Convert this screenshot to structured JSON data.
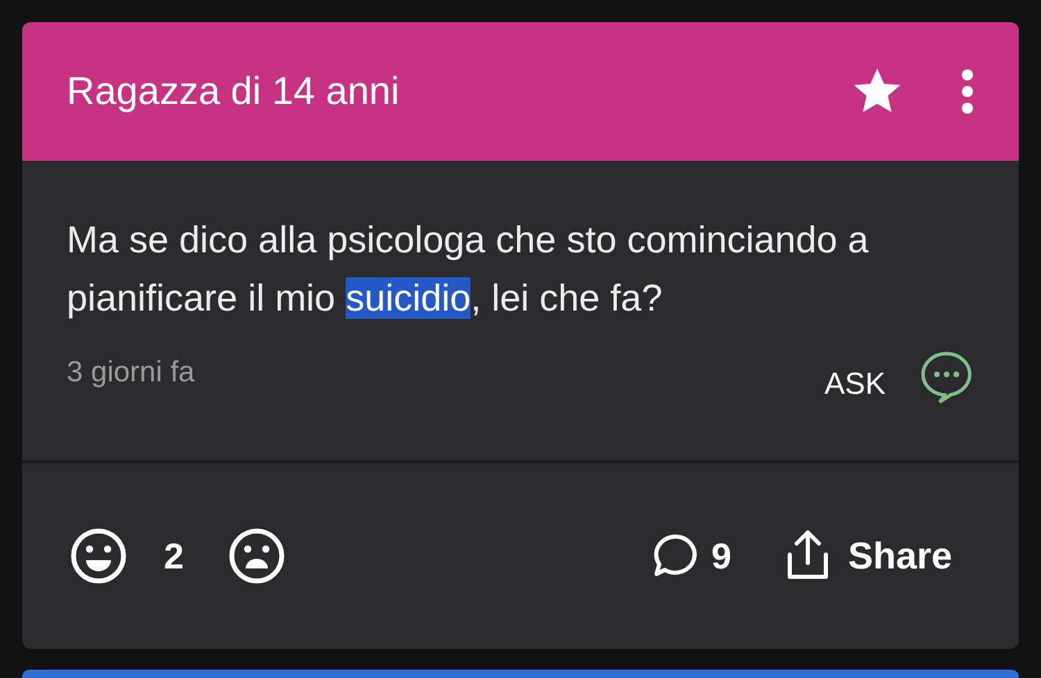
{
  "post": {
    "title": "Ragazza di 14 anni",
    "starred": true,
    "body": [
      {
        "text": "Ma se dico alla psicologa che sto cominciando a pianificare il mio ",
        "selected": false
      },
      {
        "text": "suicidio",
        "selected": true
      },
      {
        "text": ", lei che fa?",
        "selected": false
      }
    ],
    "time": "3 giorni fa",
    "ask_label": "ASK",
    "likes": "2",
    "comments": "9",
    "share_label": "Share"
  }
}
